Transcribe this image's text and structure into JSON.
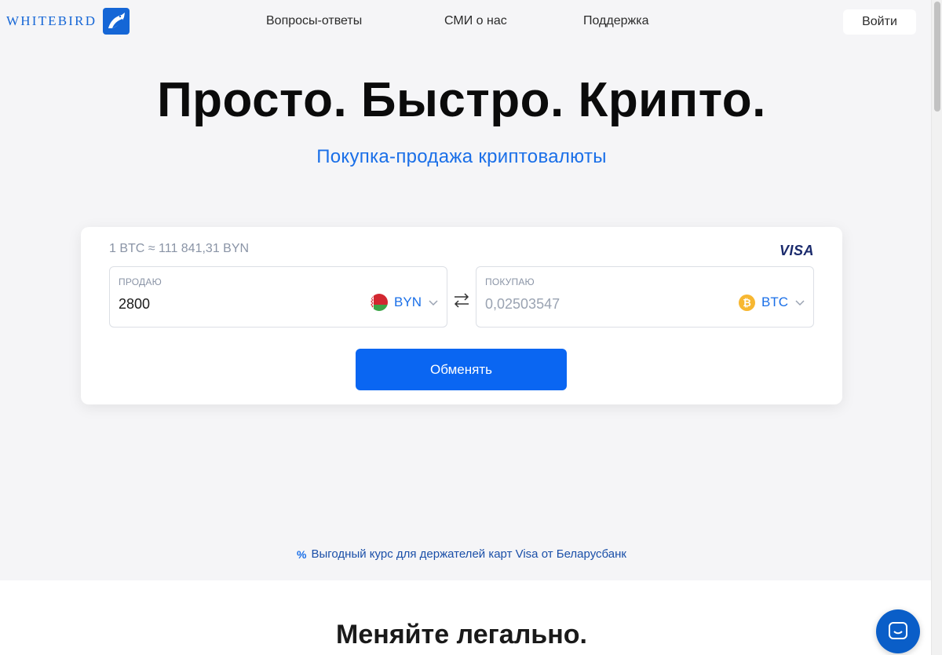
{
  "header": {
    "logo_text": "WHITEBIRD",
    "nav": [
      {
        "label": "Вопросы-ответы"
      },
      {
        "label": "СМИ о нас"
      },
      {
        "label": "Поддержка"
      }
    ],
    "login_label": "Войти"
  },
  "hero": {
    "title": "Просто. Быстро. Крипто.",
    "subtitle": "Покупка-продажа криптовалюты"
  },
  "exchange": {
    "rate": "1 BTC ≈ 111 841,31 BYN",
    "card_brand": "VISA",
    "sell": {
      "label": "ПРОДАЮ",
      "value": "2800",
      "currency": "BYN"
    },
    "buy": {
      "label": "ПОКУПАЮ",
      "placeholder": "0,02503547",
      "currency": "BTC",
      "currency_icon": "₿"
    },
    "button_label": "Обменять"
  },
  "promo": {
    "icon": "%",
    "text": "Выгодный курс для держателей карт Visa от Беларусбанк"
  },
  "lower": {
    "title": "Меняйте легально."
  },
  "colors": {
    "accent": "#0a66f2",
    "link": "#1a6fe8",
    "background": "#f5f5f7",
    "bitcoin": "#f7b731"
  },
  "icons": {
    "logo": "bird-logo-icon",
    "swap": "swap-arrows-icon",
    "chevron": "chevron-down-icon",
    "flag": "belarus-flag-icon",
    "chat": "chat-icon"
  }
}
